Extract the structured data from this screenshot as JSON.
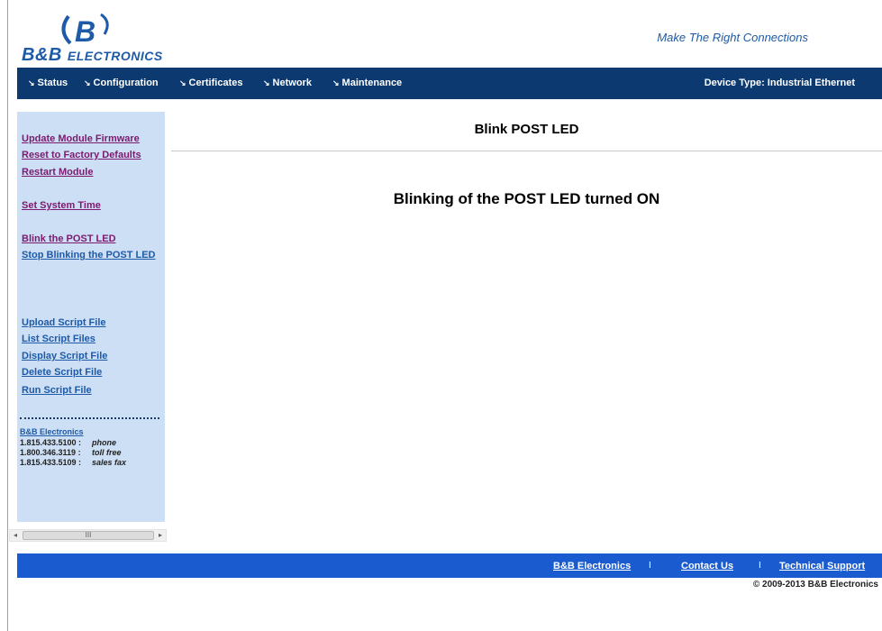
{
  "header": {
    "logo_text_main": "B&B",
    "logo_text_rest": "Electronics",
    "logo_mark": "B",
    "tagline": "Make The Right Connections"
  },
  "nav": {
    "arrow": "↘",
    "items": [
      {
        "label": "Status"
      },
      {
        "label": "Configuration"
      },
      {
        "label": "Certificates"
      },
      {
        "label": "Network"
      },
      {
        "label": "Maintenance"
      }
    ],
    "device_type": "Device Type: Industrial Ethernet"
  },
  "sidebar": {
    "links": [
      {
        "label": "Update Module Firmware",
        "visited": true
      },
      {
        "label": "Reset to Factory Defaults",
        "visited": true
      },
      {
        "label": "Restart Module",
        "visited": true
      },
      {
        "label": "Set System Time",
        "visited": true
      },
      {
        "label": "Blink the POST LED",
        "visited": true
      },
      {
        "label": "Stop Blinking the POST LED",
        "visited": false
      },
      {
        "label": "Upload Script File",
        "visited": false
      },
      {
        "label": "List Script Files",
        "visited": false
      },
      {
        "label": "Display Script File",
        "visited": false
      },
      {
        "label": "Delete Script File",
        "visited": false
      },
      {
        "label": "Run Script File",
        "visited": false
      }
    ],
    "contact": {
      "company": "B&B Electronics",
      "rows": [
        {
          "number": "1.815.433.5100 :",
          "label": "phone"
        },
        {
          "number": "1.800.346.3119 :",
          "label": "toll free"
        },
        {
          "number": "1.815.433.5109 :",
          "label": "sales fax"
        }
      ]
    }
  },
  "main": {
    "title": "Blink POST LED",
    "message": "Blinking of the POST LED turned ON"
  },
  "scrollbar": {
    "left_arrow": "◂",
    "right_arrow": "▸",
    "grip": "III"
  },
  "footer": {
    "links": [
      {
        "label": "B&B Electronics"
      },
      {
        "label": "Contact Us"
      },
      {
        "label": "Technical Support"
      }
    ],
    "separator": "I",
    "copyright": "© 2009-2013 B&B Electronics"
  },
  "colors": {
    "nav_bg": "#0c3a70",
    "sidebar_bg": "#cddff4",
    "footer_bg": "#1a5bd0",
    "brand_blue": "#1d5aa8",
    "visited_link": "#7b1a6f"
  }
}
